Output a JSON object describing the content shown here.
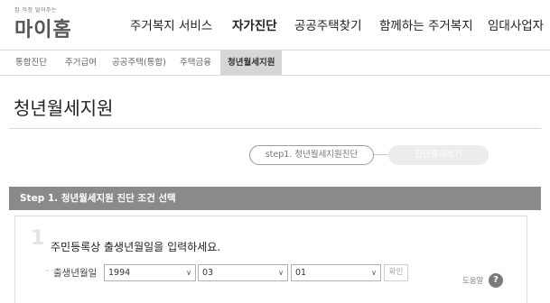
{
  "logo": {
    "tagline": "집 걱정 덜어주는",
    "text": "마이홈"
  },
  "gnb": {
    "items": [
      {
        "label": "주거복지 서비스"
      },
      {
        "label": "자가진단"
      },
      {
        "label": "공공주택찾기"
      },
      {
        "label": "함께하는 주거복지"
      },
      {
        "label": "임대사업자"
      }
    ],
    "active": "자가진단"
  },
  "subnav": {
    "items": [
      {
        "label": "통합진단"
      },
      {
        "label": "주거급여"
      },
      {
        "label": "공공주택(통합)"
      },
      {
        "label": "주택금융"
      },
      {
        "label": "청년월세지원"
      }
    ],
    "active": "청년월세지원"
  },
  "page": {
    "title": "청년월세지원"
  },
  "steps": {
    "step1": "step1. 청년월세지원진단",
    "step2": "진단결과보기"
  },
  "section": {
    "title": "Step 1. 청년월세지원 진단 조건 선택"
  },
  "question": {
    "number": "1",
    "text": "주민등록상 출생년월일을 입력하세요.",
    "field_label": "출생년월일",
    "year": "1994",
    "month": "03",
    "day": "01",
    "confirm_label": "확인"
  },
  "help": {
    "label": "도움말",
    "icon": "?"
  }
}
